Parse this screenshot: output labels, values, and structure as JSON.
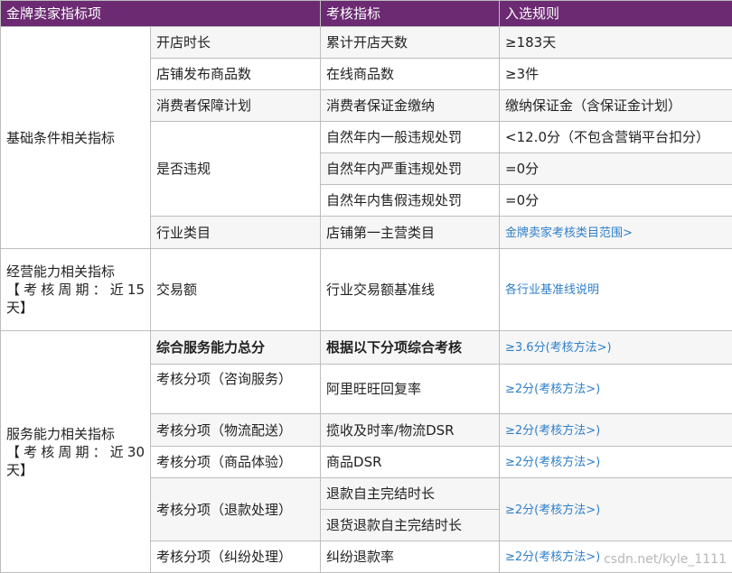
{
  "header": [
    "金牌卖家指标项",
    "",
    "考核指标",
    "入选规则"
  ],
  "groups": {
    "basic": "基础条件相关指标",
    "operation": {
      "title": "经营能力相关指标",
      "period": "【考核周期：近15",
      "period_end": "天】"
    },
    "service": {
      "title": "服务能力相关指标",
      "period": "【考核周期：近30",
      "period_end": "天】"
    }
  },
  "rows": {
    "r1": {
      "item": "开店时长",
      "metric": "累计开店天数",
      "rule": "≥183天"
    },
    "r2": {
      "item": "店铺发布商品数",
      "metric": "在线商品数",
      "rule": "≥3件"
    },
    "r3": {
      "item": "消费者保障计划",
      "metric": "消费者保证金缴纳",
      "rule": "缴纳保证金（含保证金计划）"
    },
    "r4": {
      "item": "是否违规",
      "metric": "自然年内一般违规处罚",
      "rule": "<12.0分（不包含营销平台扣分）"
    },
    "r5": {
      "metric": "自然年内严重违规处罚",
      "rule": "=0分"
    },
    "r6": {
      "metric": "自然年内售假违规处罚",
      "rule": "=0分"
    },
    "r7": {
      "item": "行业类目",
      "metric": "店铺第一主营类目",
      "rule": "金牌卖家考核类目范围>"
    },
    "r8": {
      "item": "交易额",
      "metric": "行业交易额基准线",
      "rule": "各行业基准线说明"
    },
    "r9": {
      "item": "综合服务能力总分",
      "metric": "根据以下分项综合考核",
      "rule": "≥3.6分(考核方法>)"
    },
    "r10": {
      "item": "考核分项（咨询服务）",
      "metric": "阿里旺旺回复率",
      "rule": "≥2分(考核方法>)"
    },
    "r11": {
      "item": "考核分项（物流配送）",
      "metric": "揽收及时率/物流DSR",
      "rule": "≥2分(考核方法>)"
    },
    "r12": {
      "item": "考核分项（商品体验）",
      "metric": "商品DSR",
      "rule": "≥2分(考核方法>)"
    },
    "r13": {
      "item": "考核分项（退款处理）",
      "metric": "退款自主完结时长",
      "rule": "≥2分(考核方法>)"
    },
    "r14": {
      "metric": "退货退款自主完结时长"
    },
    "r15": {
      "item": "考核分项（纠纷处理）",
      "metric": "纠纷退款率",
      "rule": "≥2分(考核方法>)"
    }
  },
  "watermark": "csdn.net/kyle_1111",
  "colors": {
    "header_bg": "#6b2a72",
    "link": "#2f7fc9"
  }
}
